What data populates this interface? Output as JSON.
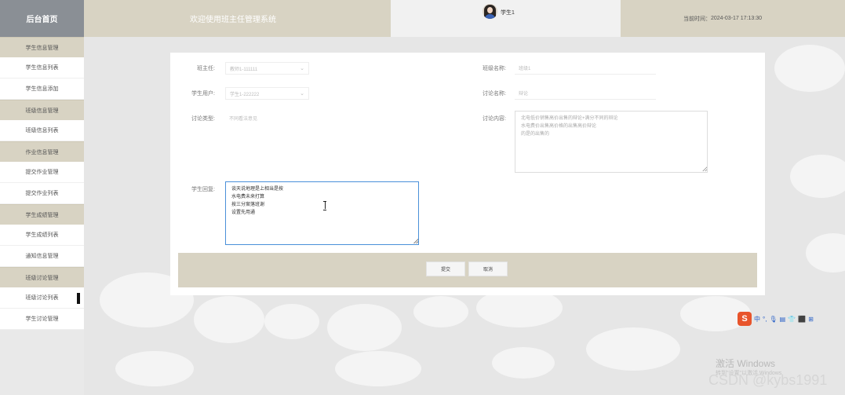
{
  "sidebar": {
    "home": "后台首页",
    "items": [
      {
        "label": "学生信息管理",
        "type": "section"
      },
      {
        "label": "学生信息列表",
        "type": "sub"
      },
      {
        "label": "学生信息添加",
        "type": "sub"
      },
      {
        "label": "班级信息管理",
        "type": "section"
      },
      {
        "label": "班级信息列表",
        "type": "sub"
      },
      {
        "label": "作业信息管理",
        "type": "section"
      },
      {
        "label": "提交作业管理",
        "type": "sub"
      },
      {
        "label": "提交作业列表",
        "type": "sub"
      },
      {
        "label": "学生成绩管理",
        "type": "section"
      },
      {
        "label": "学生成绩列表",
        "type": "sub"
      },
      {
        "label": "通知信息管理",
        "type": "sub"
      },
      {
        "label": "班级讨论管理",
        "type": "section"
      },
      {
        "label": "班级讨论列表",
        "type": "sub",
        "selected": true
      },
      {
        "label": "学生讨论管理",
        "type": "sub"
      }
    ]
  },
  "header": {
    "welcome": "欢迎使用班主任管理系统",
    "user": "学生1",
    "time_label": "当前时间：",
    "time_value": "2024-03-17 17:13:30"
  },
  "form": {
    "teacher_label": "班主任:",
    "teacher_value": "教师1-111111",
    "class_name_label": "班级名称:",
    "class_name_value": "班级1",
    "student_label": "学生用户:",
    "student_value": "学生1-222222",
    "topic_label": "讨论名称:",
    "topic_value": "辩论",
    "type_label": "讨论类型:",
    "type_value": "不同看法意见",
    "content_label": "讨论内容:",
    "content_value": "北电低价销售高价出售的辩论+满分不同的辩论\n水电费价出售高价格的出售高价辩论\n的是的出售的",
    "reply_label": "学生回复:",
    "reply_value": "谈天说地理是上相当是按\n水电费未来打算\n按三分案落班谢\n设置先用通"
  },
  "actions": {
    "submit": "提交",
    "cancel": "取消"
  },
  "ime": {
    "logo": "S",
    "mode": "中"
  },
  "watermarks": {
    "windows_title": "激活 Windows",
    "windows_sub": "转到\"设置\"以激活 Windows",
    "csdn": "CSDN @kybs1991"
  }
}
